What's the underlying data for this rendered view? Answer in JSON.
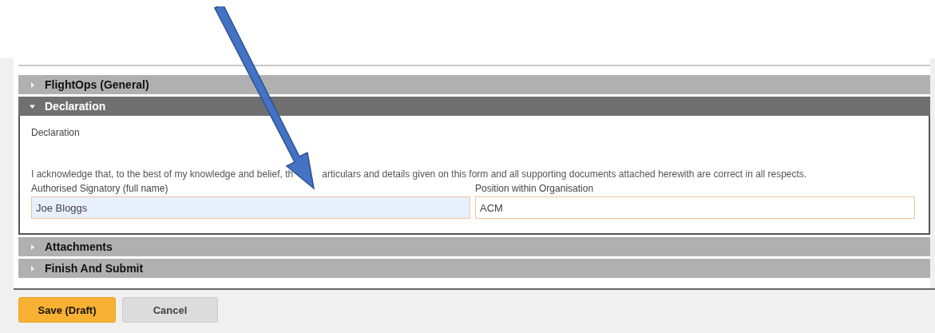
{
  "sections": [
    {
      "title": "FlightOps (General)",
      "expanded": false
    },
    {
      "title": "Declaration",
      "expanded": true,
      "heading": "Declaration",
      "statement": [
        "I acknowledge that, to the best of my knowledge and belief, th",
        "articulars and details given on this form and all supporting documents attached herewith are correct in all respects."
      ],
      "fields": [
        {
          "label": "Authorised Signatory (full name)",
          "value": "Joe Bloggs",
          "autofilled": true
        },
        {
          "label": "Position within Organisation",
          "value": "ACM",
          "autofilled": false
        }
      ]
    },
    {
      "title": "Attachments",
      "expanded": false
    },
    {
      "title": "Finish And Submit",
      "expanded": false
    }
  ],
  "buttons": [
    {
      "label": "Save (Draft)",
      "kind": "primary"
    },
    {
      "label": "Cancel",
      "kind": "secondary"
    }
  ]
}
